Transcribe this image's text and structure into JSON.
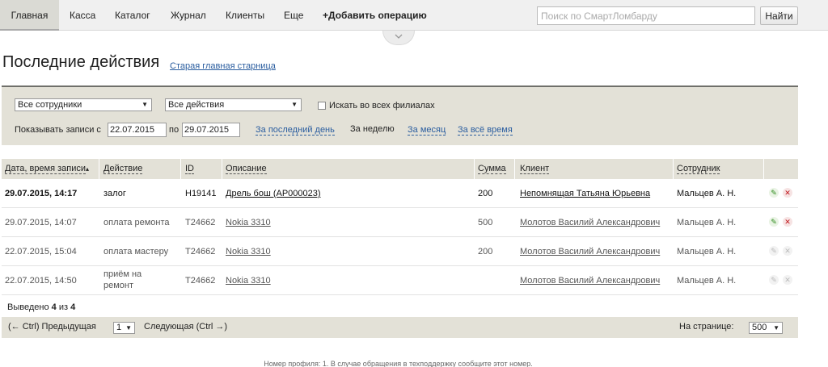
{
  "nav": {
    "items": [
      {
        "label": "Главная",
        "active": true
      },
      {
        "label": "Касса"
      },
      {
        "label": "Каталог"
      },
      {
        "label": "Журнал"
      },
      {
        "label": "Клиенты"
      },
      {
        "label": "Еще"
      }
    ],
    "add_operation": "+Добавить операцию",
    "search_placeholder": "Поиск по СмартЛомбарду",
    "search_button": "Найти",
    "toggle_icon": "chevron-down-icon"
  },
  "page": {
    "title": "Последние действия",
    "old_link": "Старая главная старница"
  },
  "filters": {
    "employees_select": "Все сотрудники",
    "actions_select": "Все действия",
    "all_branches_label": "Искать во всех филиалах",
    "all_branches_checked": false,
    "show_from_label": "Показывать записи с",
    "date_from": "22.07.2015",
    "to_label": "по",
    "date_to": "29.07.2015",
    "periods": {
      "last_day": "За последний день",
      "week": "За неделю",
      "month": "За месяц",
      "all_time": "За всё время"
    }
  },
  "table": {
    "headers": {
      "date": "Дата, время записи",
      "action": "Действие",
      "id": "ID",
      "description": "Описание",
      "sum": "Сумма",
      "client": "Клиент",
      "employee": "Сотрудник"
    },
    "sort_indicator": "▴",
    "rows": [
      {
        "date": "29.07.2015, 14:17",
        "action": "залог",
        "id": "Н19141",
        "description": "Дрель бош (АР000023)",
        "sum": "200",
        "sum_color": "#c0141a",
        "client": "Непомнящая Татьяна Юрьевна",
        "employee": "Мальцев А. Н."
      },
      {
        "date": "29.07.2015, 14:07",
        "action": "оплата ремонта",
        "id": "Т24662",
        "description": "Nokia 3310",
        "sum": "500",
        "sum_color": "#2c8a1c",
        "client": "Молотов Василий Александрович",
        "employee": "Мальцев А. Н."
      },
      {
        "date": "22.07.2015, 15:04",
        "action": "оплата мастеру",
        "id": "Т24662",
        "description": "Nokia 3310",
        "sum": "200",
        "sum_color": "#c0141a",
        "client": "Молотов Василий Александрович",
        "employee": "Мальцев А. Н."
      },
      {
        "date": "22.07.2015, 14:50",
        "action_line1": "приём на",
        "action_line2": "ремонт",
        "id": "Т24662",
        "description": "Nokia 3310",
        "sum": "",
        "client": "Молотов Василий Александрович",
        "employee": "Мальцев А. Н."
      }
    ]
  },
  "summary": {
    "prefix": "Выведено",
    "shown": "4",
    "of": "из",
    "total": "4"
  },
  "pager": {
    "prev": "(← Ctrl) Предыдущая",
    "page": "1",
    "next": "Следующая (Ctrl →)",
    "per_page_label": "На странице:",
    "per_page": "500"
  },
  "footer": {
    "note": "Номер профиля: 1. В случае обращения в техподдержку сообщите этот номер."
  },
  "colors": {
    "link": "#2a5d9f",
    "panel": "#e3e1d7",
    "negative": "#c0141a",
    "positive": "#2c8a1c"
  }
}
